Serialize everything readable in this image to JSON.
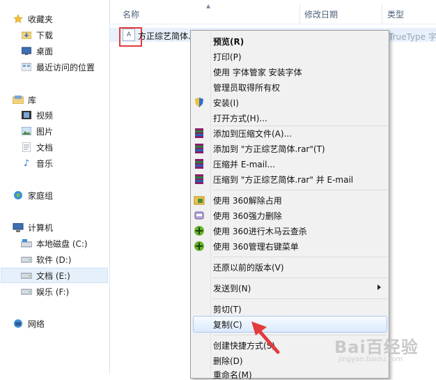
{
  "sidebar": {
    "favorites": {
      "label": "收藏夹"
    },
    "favorites_items": [
      {
        "label": "下载"
      },
      {
        "label": "桌面"
      },
      {
        "label": "最近访问的位置"
      }
    ],
    "library": {
      "label": "库"
    },
    "library_items": [
      {
        "label": "视频"
      },
      {
        "label": "图片"
      },
      {
        "label": "文档"
      },
      {
        "label": "音乐"
      }
    ],
    "homegroup": {
      "label": "家庭组"
    },
    "computer": {
      "label": "计算机"
    },
    "computer_items": [
      {
        "label": "本地磁盘 (C:)"
      },
      {
        "label": "软件 (D:)"
      },
      {
        "label": "文档 (E:)"
      },
      {
        "label": "娱乐 (F:)"
      }
    ],
    "network": {
      "label": "网络"
    }
  },
  "columns": {
    "name": "名称",
    "modified": "修改日期",
    "type": "类型"
  },
  "file": {
    "name": "方正综艺简体.",
    "type": "TrueType 字"
  },
  "menu": {
    "items": [
      {
        "label": "预览(R)"
      },
      {
        "label": "打印(P)"
      },
      {
        "label": "使用 字体管家 安装字体"
      },
      {
        "label": "管理员取得所有权"
      },
      {
        "label": "安装(I)"
      },
      {
        "label": "打开方式(H)..."
      },
      {
        "label": "添加到压缩文件(A)..."
      },
      {
        "label": "添加到 \"方正综艺简体.rar\"(T)"
      },
      {
        "label": "压缩并 E-mail..."
      },
      {
        "label": "压缩到 \"方正综艺简体.rar\" 并 E-mail"
      },
      {
        "label": "使用 360解除占用"
      },
      {
        "label": "使用 360强力删除"
      },
      {
        "label": "使用 360进行木马云查杀"
      },
      {
        "label": "使用 360管理右键菜单"
      },
      {
        "label": "还原以前的版本(V)"
      },
      {
        "label": "发送到(N)"
      },
      {
        "label": "剪切(T)"
      },
      {
        "label": "复制(C)"
      },
      {
        "label": "创建快捷方式(S)"
      },
      {
        "label": "删除(D)"
      },
      {
        "label": "重命名(M)"
      }
    ]
  },
  "watermark": {
    "text": "Bai百经验",
    "sub": "jingyan.baidu.com"
  },
  "colors": {
    "highlight_red": "#e23b3b",
    "selection_blue": "#dbeafb"
  }
}
